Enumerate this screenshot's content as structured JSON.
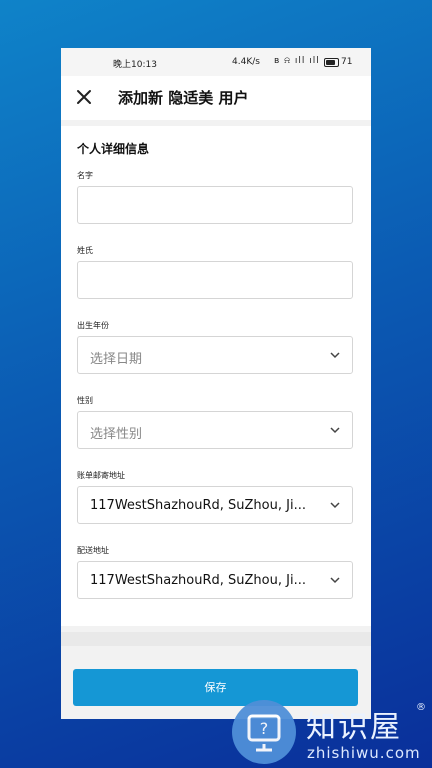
{
  "status_bar": {
    "time": "晚上10:13",
    "network_speed": "4.4K/s",
    "status_icons": "ʙ ⍾ ıll ıll",
    "battery": "71"
  },
  "header": {
    "close_icon": "close-icon",
    "title": "添加新 隐适美 用户"
  },
  "form": {
    "section_title": "个人详细信息",
    "first_name": {
      "label": "名字",
      "value": ""
    },
    "last_name": {
      "label": "姓氏",
      "value": ""
    },
    "birth_year": {
      "label": "出生年份",
      "placeholder": "选择日期"
    },
    "gender": {
      "label": "性别",
      "placeholder": "选择性别"
    },
    "billing_address": {
      "label": "账单邮寄地址",
      "value": "117WestShazhouRd, SuZhou, Ji..."
    },
    "shipping_address": {
      "label": "配送地址",
      "value": "117WestShazhouRd, SuZhou, Ji..."
    }
  },
  "actions": {
    "save_label": "保存"
  },
  "watermark": {
    "title": "知识屋",
    "registered": "®",
    "url": "zhishiwu.com"
  },
  "colors": {
    "primary_button": "#1597d5",
    "background_top": "#0f83c9",
    "background_bottom": "#0a2f9a"
  }
}
